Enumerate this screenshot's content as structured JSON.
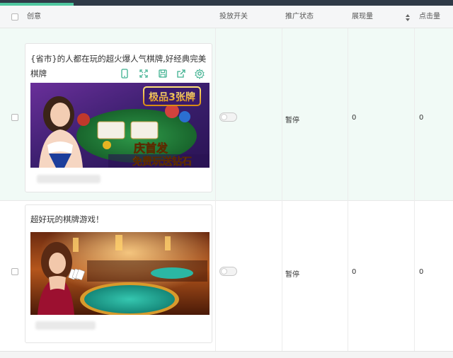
{
  "header": {
    "creative": "创意",
    "delivery_switch": "投放开关",
    "promo_status": "推广状态",
    "impressions": "展现量",
    "clicks": "点击量"
  },
  "rows": [
    {
      "title": "{省市}的人都在玩的超火爆人气棋牌,好经典完美棋牌",
      "image_text_top": "极品3张牌",
      "image_text_mid": "庆首发",
      "image_text_bottom": "免费玩送钻石",
      "status": "暂停",
      "impressions": "0",
      "clicks": "0",
      "toolbar_icons": [
        "phone-preview-icon",
        "expand-icon",
        "save-icon",
        "share-icon",
        "settings-icon"
      ]
    },
    {
      "title": "超好玩的棋牌游戏！",
      "status": "暂停",
      "impressions": "0",
      "clicks": "0"
    }
  ],
  "colors": {
    "accent": "#4fc7a0",
    "selected_row_bg": "#f1faf6",
    "topbar": "#2f3a47"
  }
}
